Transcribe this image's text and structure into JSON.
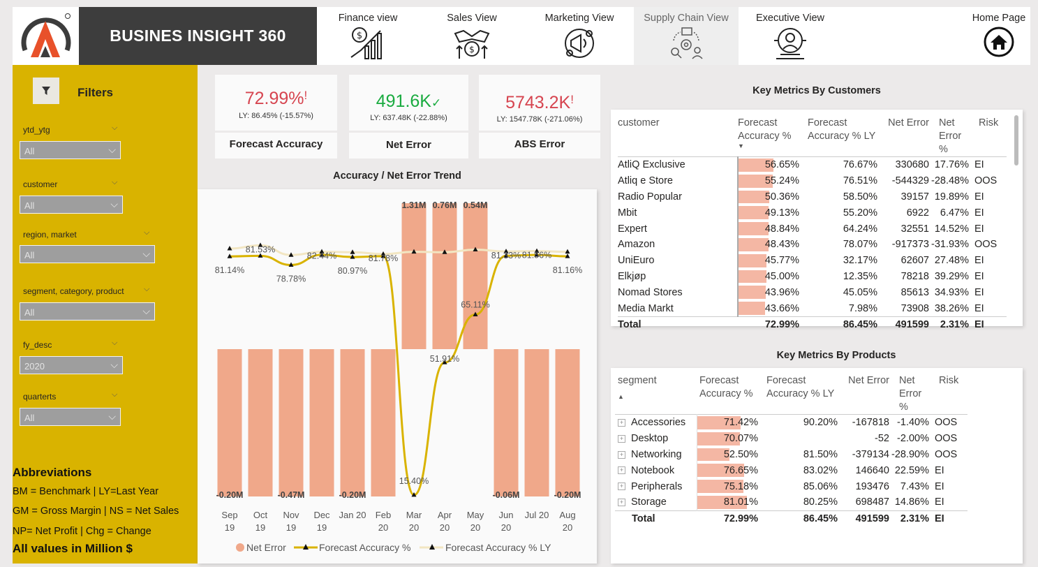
{
  "header": {
    "title": "BUSINES INSIGHT 360",
    "nav": [
      {
        "label": "Finance view",
        "icon": "finance-icon"
      },
      {
        "label": "Sales View",
        "icon": "sales-handshake-icon"
      },
      {
        "label": "Marketing View",
        "icon": "marketing-icon"
      },
      {
        "label": "Supply Chain View",
        "icon": "supply-chain-icon",
        "active": true
      },
      {
        "label": "Executive View",
        "icon": "executive-icon"
      },
      {
        "label": "Home Page",
        "icon": "home-icon"
      }
    ]
  },
  "sidebar": {
    "filters_title": "Filters",
    "slicers": [
      {
        "label": "ytd_ytg",
        "value": "All"
      },
      {
        "label": "customer",
        "value": "All"
      },
      {
        "label": "region, market",
        "value": "All"
      },
      {
        "label": "segment, category, product",
        "value": "All"
      },
      {
        "label": "fy_desc",
        "value": "2020"
      },
      {
        "label": "quarterts",
        "value": "All"
      }
    ],
    "abbr_title": "Abbreviations",
    "abbr_lines": [
      "BM = Benchmark | LY=Last Year",
      "GM = Gross Margin | NS = Net Sales",
      "NP= Net Profit | Chg = Change"
    ],
    "abbr_footer": "All values in Million $"
  },
  "kpis": [
    {
      "value": "72.99%",
      "indicator": "!",
      "ly": "LY: 86.45% (-15.57%)",
      "name": "Forecast Accuracy",
      "color": "#d64550"
    },
    {
      "value": "491.6K",
      "indicator": "✓",
      "ly": "LY: 637.48K (-22.88%)",
      "name": "Net Error",
      "color": "#1aab40"
    },
    {
      "value": "5743.2K",
      "indicator": "!",
      "ly": "LY: 1547.78K (-271.06%)",
      "name": "ABS Error",
      "color": "#d64550"
    }
  ],
  "chart_data": {
    "type": "bar",
    "title": "Accuracy / Net Error Trend",
    "categories": [
      "Sep 19",
      "Oct 19",
      "Nov 19",
      "Dec 19",
      "Jan 20",
      "Feb 20",
      "Mar 20",
      "Apr 20",
      "May 20",
      "Jun 20",
      "Jul 20",
      "Aug 20"
    ],
    "series": [
      {
        "name": "Net Error",
        "type": "bar",
        "values": [
          -0.2,
          -0.2,
          -0.47,
          -0.2,
          -0.2,
          -0.2,
          1.31,
          0.76,
          0.54,
          -0.06,
          -0.2,
          -0.2
        ],
        "color": "#f0a88a"
      },
      {
        "name": "Forecast Accuracy %",
        "type": "line",
        "values": [
          81.14,
          81.3,
          78.78,
          81.6,
          80.97,
          81.2,
          15.4,
          51.91,
          65.11,
          81.33,
          81.56,
          81.16
        ],
        "color": "#d9b300"
      },
      {
        "name": "Forecast Accuracy % LY",
        "type": "line",
        "values": [
          83.3,
          84.2,
          81.53,
          82.44,
          82.3,
          81.78,
          82.4,
          82.3,
          83.0,
          82.5,
          82.6,
          82.4
        ],
        "color": "#f2e6c2"
      }
    ],
    "bar_labels": [
      {
        "index": 0,
        "text": "-0.20M"
      },
      {
        "index": 2,
        "text": "-0.47M"
      },
      {
        "index": 4,
        "text": "-0.20M"
      },
      {
        "index": 6,
        "text": "1.31M"
      },
      {
        "index": 7,
        "text": "0.76M"
      },
      {
        "index": 8,
        "text": "0.54M"
      },
      {
        "index": 9,
        "text": "-0.06M"
      },
      {
        "index": 11,
        "text": "-0.20M"
      }
    ],
    "acc_labels": [
      {
        "index": 0,
        "text": "81.14%"
      },
      {
        "index": 2,
        "text": "78.78%"
      },
      {
        "index": 4,
        "text": "80.97%"
      },
      {
        "index": 6,
        "text": "15.40%"
      },
      {
        "index": 7,
        "text": "51.91%"
      },
      {
        "index": 8,
        "text": "65.11%"
      },
      {
        "index": 11,
        "text": "81.16%"
      }
    ],
    "ly_labels": [
      {
        "index": 1,
        "text": "81.53%"
      },
      {
        "index": 3,
        "text": "82.44%"
      },
      {
        "index": 5,
        "text": "81.78%"
      },
      {
        "index": 9,
        "text": "81.33%"
      },
      {
        "index": 10,
        "text": "81.56%"
      }
    ],
    "legend": [
      "Net Error",
      "Forecast Accuracy %",
      "Forecast Accuracy % LY"
    ]
  },
  "customers_table": {
    "title": "Key Metrics By Customers",
    "headers": [
      "customer",
      "Forecast Accuracy %",
      "Forecast Accuracy % LY",
      "Net Error",
      "Net Error %",
      "Risk"
    ],
    "rows": [
      {
        "name": "AtliQ Exclusive",
        "fa": "56.65%",
        "fa_val": 56.65,
        "faly": "76.67%",
        "ne": "330680",
        "nep": "17.76%",
        "risk": "EI"
      },
      {
        "name": "Atliq e Store",
        "fa": "55.24%",
        "fa_val": 55.24,
        "faly": "76.51%",
        "ne": "-544329",
        "nep": "-28.48%",
        "risk": "OOS"
      },
      {
        "name": "Radio Popular",
        "fa": "50.36%",
        "fa_val": 50.36,
        "faly": "58.50%",
        "ne": "39157",
        "nep": "19.89%",
        "risk": "EI"
      },
      {
        "name": "Mbit",
        "fa": "49.13%",
        "fa_val": 49.13,
        "faly": "55.20%",
        "ne": "6922",
        "nep": "6.47%",
        "risk": "EI"
      },
      {
        "name": "Expert",
        "fa": "48.84%",
        "fa_val": 48.84,
        "faly": "64.24%",
        "ne": "32551",
        "nep": "14.52%",
        "risk": "EI"
      },
      {
        "name": "Amazon",
        "fa": "48.43%",
        "fa_val": 48.43,
        "faly": "78.07%",
        "ne": "-917373",
        "nep": "-31.93%",
        "risk": "OOS"
      },
      {
        "name": "UniEuro",
        "fa": "45.77%",
        "fa_val": 45.77,
        "faly": "32.17%",
        "ne": "62607",
        "nep": "27.48%",
        "risk": "EI"
      },
      {
        "name": "Elkjøp",
        "fa": "45.00%",
        "fa_val": 45.0,
        "faly": "12.35%",
        "ne": "78218",
        "nep": "39.29%",
        "risk": "EI"
      },
      {
        "name": "Nomad Stores",
        "fa": "43.96%",
        "fa_val": 43.96,
        "faly": "45.05%",
        "ne": "85613",
        "nep": "34.93%",
        "risk": "EI"
      },
      {
        "name": "Media Markt",
        "fa": "43.66%",
        "fa_val": 43.66,
        "faly": "7.98%",
        "ne": "73908",
        "nep": "38.26%",
        "risk": "EI"
      }
    ],
    "total": {
      "name": "Total",
      "fa": "72.99%",
      "faly": "86.45%",
      "ne": "491599",
      "nep": "2.31%",
      "risk": "EI"
    }
  },
  "products_table": {
    "title": "Key Metrics By Products",
    "headers": [
      "segment",
      "Forecast Accuracy %",
      "Forecast Accuracy % LY",
      "Net Error",
      "Net Error %",
      "Risk"
    ],
    "rows": [
      {
        "name": "Accessories",
        "fa": "71.42%",
        "fa_val": 71.42,
        "faly": "90.20%",
        "ne": "-167818",
        "nep": "-1.40%",
        "risk": "OOS"
      },
      {
        "name": "Desktop",
        "fa": "70.07%",
        "fa_val": 70.07,
        "faly": "",
        "ne": "-52",
        "nep": "-2.00%",
        "risk": "OOS"
      },
      {
        "name": "Networking",
        "fa": "52.50%",
        "fa_val": 52.5,
        "faly": "81.50%",
        "ne": "-379134",
        "nep": "-28.90%",
        "risk": "OOS"
      },
      {
        "name": "Notebook",
        "fa": "76.65%",
        "fa_val": 76.65,
        "faly": "83.02%",
        "ne": "146640",
        "nep": "22.59%",
        "risk": "EI"
      },
      {
        "name": "Peripherals",
        "fa": "75.18%",
        "fa_val": 75.18,
        "faly": "85.06%",
        "ne": "193476",
        "nep": "7.43%",
        "risk": "EI"
      },
      {
        "name": "Storage",
        "fa": "81.01%",
        "fa_val": 81.01,
        "faly": "80.25%",
        "ne": "698487",
        "nep": "14.86%",
        "risk": "EI"
      }
    ],
    "total": {
      "name": "Total",
      "fa": "72.99%",
      "faly": "86.45%",
      "ne": "491599",
      "nep": "2.31%",
      "risk": "EI"
    }
  }
}
